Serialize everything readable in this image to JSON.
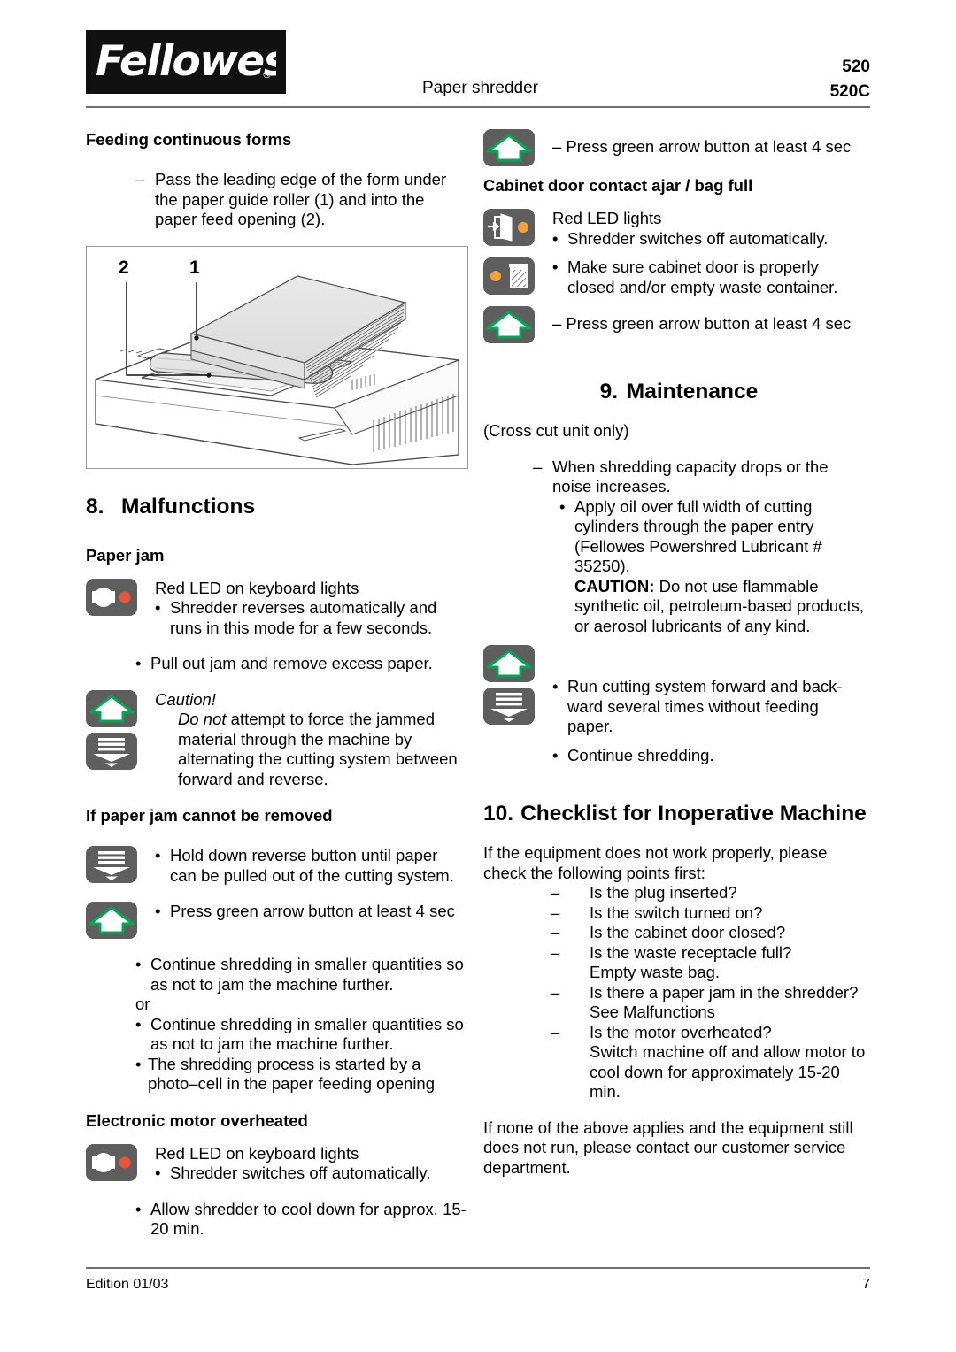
{
  "header": {
    "logo_text": "Fellowes",
    "logo_registered": "®",
    "subtitle": "Paper shredder",
    "model_1": "520",
    "model_2": "520C"
  },
  "left": {
    "feeding_heading": "Feeding continuous forms",
    "feeding_dash": "–",
    "feeding_text": "Pass the leading edge of the form under the paper guide roller (1) and into the paper feed opening (2).",
    "figure": {
      "label_2": "2",
      "label_1": "1"
    },
    "malfunctions_num": "8.",
    "malfunctions_title": "Malfunctions",
    "paper_jam_heading": "Paper jam",
    "paper_jam_led_text": "Red LED on keyboard lights",
    "paper_jam_b1": "Shredder reverses automatically and runs in this mode for a few seconds.",
    "paper_jam_b2": "Pull out jam and remove excess paper.",
    "caution_label": "Caution!",
    "caution_emph": "Do not",
    "caution_text": " attempt to force the jammed material through the machine by alternating the cutting system between forward and reverse.",
    "jam_not_removed_heading": "If paper jam cannot be removed",
    "jam_b1": "Hold down reverse button until paper can be pulled out of the cutting system.",
    "jam_b2": "Press green arrow button at least 4 sec",
    "jam_b3": "Continue shredding in smaller quantities so as not to jam the machine further.",
    "jam_or": "or",
    "jam_b4": "Continue shredding in smaller quantities so as not to jam the machine further.",
    "jam_b5": "The shredding process is started by a photo–cell in the paper feeding opening",
    "motor_heading": "Electronic motor overheated",
    "motor_led_text": "Red LED on keyboard lights",
    "motor_b1": "Shredder switches off automatically.",
    "motor_b2": "Allow shredder to cool down for approx. 15-20 min."
  },
  "right": {
    "press_green_1": "– Press green arrow button at least 4 sec",
    "cabinet_heading": "Cabinet door contact ajar / bag full",
    "cabinet_led_text": "Red LED lights",
    "cabinet_b1": "Shredder switches off automatically.",
    "cabinet_b2": "Make sure cabinet door is properly closed and/or empty waste container.",
    "press_green_2": "– Press green arrow button at least 4 sec",
    "maintenance_num": "9.",
    "maintenance_title": "Maintenance",
    "maintenance_note": "(Cross cut unit only)",
    "maintenance_dash": "–",
    "maintenance_d1": "When shredding capacity drops or the noise increases.",
    "maintenance_b1_line1": "Apply oil over full width of cutting cylinders through the paper entry (Fellowes Powershred Lubricant # 35250).",
    "maintenance_caution_label": "CAUTION:",
    "maintenance_caution_text": " Do not use flammable synthetic oil, petroleum-based products, or aerosol lubricants of any kind.",
    "maintenance_b2": "Run cutting system forward and back-ward several times without feeding paper.",
    "maintenance_b3": "Continue shredding.",
    "checklist_num": "10.",
    "checklist_title": "Checklist for Inoperative Machine",
    "checklist_intro": "If the equipment does not work properly, please check the following points first:",
    "checklist_dash": "–",
    "checklist_items": [
      {
        "q": "Is the plug inserted?",
        "note": ""
      },
      {
        "q": "Is the switch turned on?",
        "note": ""
      },
      {
        "q": "Is the cabinet door closed?",
        "note": ""
      },
      {
        "q": "Is the waste receptacle full?",
        "note": "Empty waste bag."
      },
      {
        "q": "Is there a paper jam in the shredder?",
        "note": "See Malfunctions"
      },
      {
        "q": "Is the motor overheated?",
        "note": "Switch  machine off and allow motor to cool down for approximately 15-20 min."
      }
    ],
    "closing": "If none of the above applies and the equipment still does not run, please contact our customer service department."
  },
  "footer": {
    "edition": "Edition 01/03",
    "page": "7"
  },
  "bullets": {
    "dot": "•",
    "dash": "–"
  },
  "colors": {
    "icon_background": "#5e5e5e",
    "led_red": "#e8553a",
    "led_amber": "#f4a13c",
    "arrow_green": "#00a84f",
    "rule_gray": "#6f6f6f",
    "logo_black": "#111111"
  }
}
